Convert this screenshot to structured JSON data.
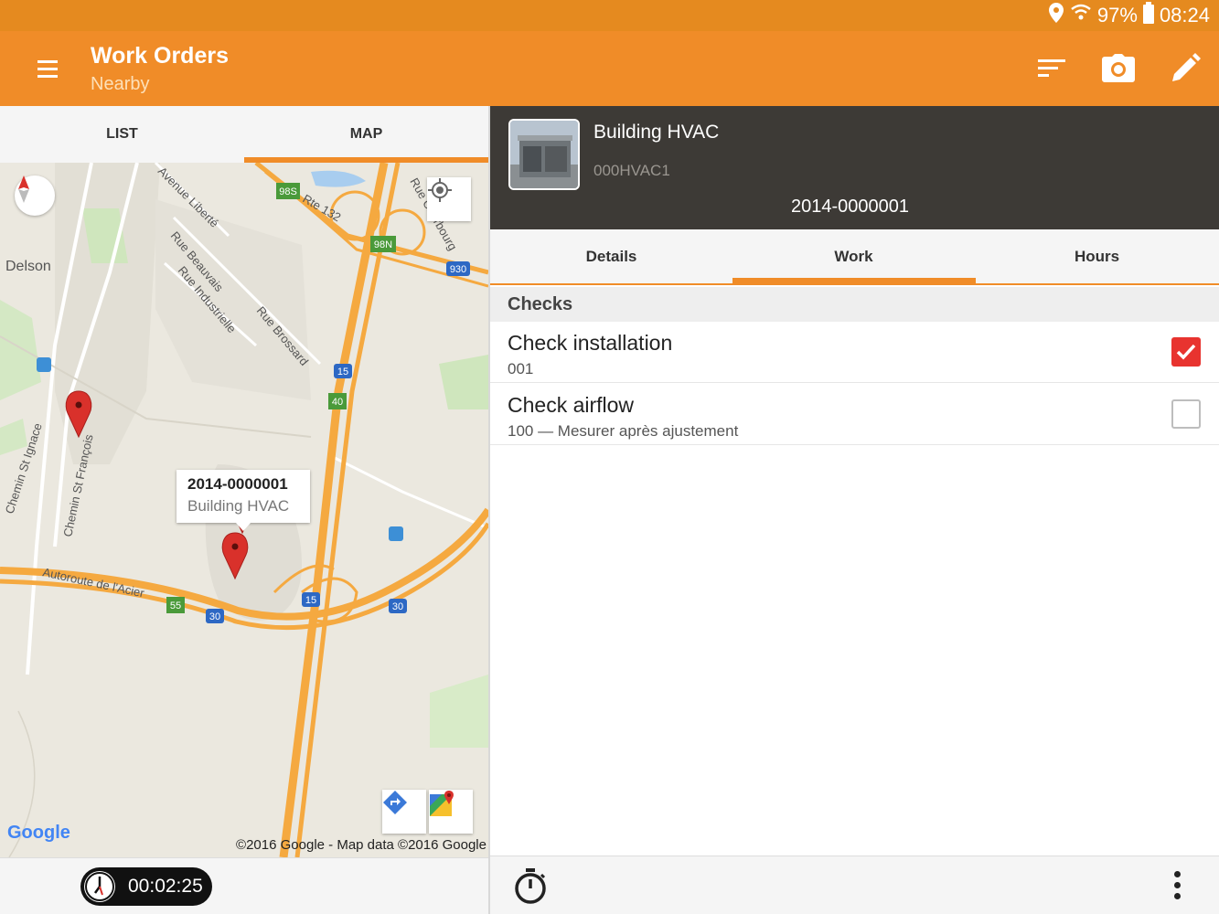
{
  "status_bar": {
    "battery": "97%",
    "time": "08:24",
    "icons": [
      "location-icon",
      "wifi-icon",
      "battery-icon"
    ]
  },
  "app_bar": {
    "title": "Work Orders",
    "subtitle": "Nearby",
    "actions": [
      "sort-icon",
      "camera-icon",
      "edit-icon"
    ]
  },
  "left_tabs": [
    {
      "label": "LIST"
    },
    {
      "label": "MAP"
    }
  ],
  "map": {
    "callout_title": "2014-0000001",
    "callout_subtitle": "Building HVAC",
    "place_labels": [
      "Delson",
      "Avenue Liberté",
      "Rue Beauvais",
      "Rue Industrielle",
      "Rue Brossard",
      "Rte 132",
      "Rue Cherbourg",
      "Chemin St François",
      "Chemin St Ignace",
      "Autoroute de l'Acier"
    ],
    "route_shields": [
      "98S",
      "98N",
      "930",
      "15",
      "40",
      "15",
      "55",
      "30",
      "30"
    ],
    "google_logo": "Google",
    "attribution": "©2016 Google - Map data ©2016 Google"
  },
  "timer": {
    "elapsed": "00:02:25"
  },
  "asset": {
    "name": "Building HVAC",
    "code": "000HVAC1",
    "work_order_number": "2014-0000001"
  },
  "right_tabs": [
    {
      "label": "Details"
    },
    {
      "label": "Work"
    },
    {
      "label": "Hours"
    }
  ],
  "checks_section": {
    "title": "Checks",
    "items": [
      {
        "title": "Check installation",
        "subtitle": "001",
        "checked": true
      },
      {
        "title": "Check airflow",
        "subtitle": "100 — Mesurer après ajustement",
        "checked": false
      }
    ]
  },
  "colors": {
    "accent": "#f08c28",
    "status_bar": "#e58a1f",
    "header_dark": "#3d3a36",
    "checkbox_on": "#e8332f"
  }
}
